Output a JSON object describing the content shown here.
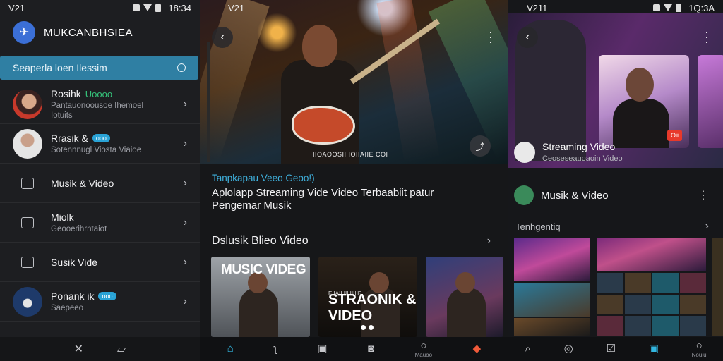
{
  "panel1": {
    "status": {
      "label": "V21",
      "time": "18:34"
    },
    "brand": "MUKCANBHSIEA",
    "search": {
      "placeholder": "Seaperla loen Ilessim"
    },
    "items": [
      {
        "title": "Rosihk",
        "badge": "Uoooo",
        "sub": "Pantauonoousoe Ihemoel",
        "sub2": "Iotuits"
      },
      {
        "title": "Rrasik &",
        "badge": "ooo",
        "sub": "Sotennnugl Viosta Viaioe"
      },
      {
        "title": "Musik & Video"
      },
      {
        "title": "Miolk",
        "sub": "Geooerihrntaiot"
      },
      {
        "title": "Susik Vide"
      },
      {
        "title": "Ponank ik",
        "badge": "ooo",
        "sub": "Saepeeo"
      }
    ],
    "bottom_nav": [
      "back-icon",
      "book-icon"
    ]
  },
  "panel2": {
    "status": {
      "label": "V21"
    },
    "hero_caption": "IIOAOOSII IOIIAIIE COI",
    "tag": "Tanpkapau Veeo Geoo!)",
    "title": "Aplolapp Streaming Vide Video  Terbaabiit patur Pengemar Musik",
    "section_title": "Dslusik Blieo Video",
    "thumbs": [
      {
        "label": "MUSIC VIDEG"
      },
      {
        "label": "STRAONIK & VIDEO",
        "small": "EIIAILIIIIIIIIIE"
      },
      {
        "label": ""
      }
    ],
    "bottom_nav": [
      {
        "icon": "home-icon",
        "label": ""
      },
      {
        "icon": "tune-icon",
        "label": ""
      },
      {
        "icon": "library-icon",
        "label": ""
      },
      {
        "icon": "camera-icon",
        "label": ""
      },
      {
        "icon": "profile-icon",
        "label": "Mauoo"
      }
    ]
  },
  "panel3": {
    "status": {
      "label": "V211",
      "time": "1Q:3A"
    },
    "stream_title": "Streaming Video",
    "stream_sub": "Ceoseseauoaoin Video",
    "rec_badge": "Oii",
    "section_title": "Musik & Video",
    "sub_title": "Tenhgentiq",
    "bottom_nav": [
      {
        "icon": "search-icon",
        "label": ""
      },
      {
        "icon": "explore-icon",
        "label": ""
      },
      {
        "icon": "check-icon",
        "label": ""
      },
      {
        "icon": "shield-icon",
        "label": ""
      },
      {
        "icon": "profile-icon",
        "label": "Nouiu"
      }
    ]
  },
  "colors": {
    "accent": "#32b6e0",
    "search_bar": "#2f7fa3",
    "badge_green": "#35c27a",
    "record": "#e8392b"
  }
}
